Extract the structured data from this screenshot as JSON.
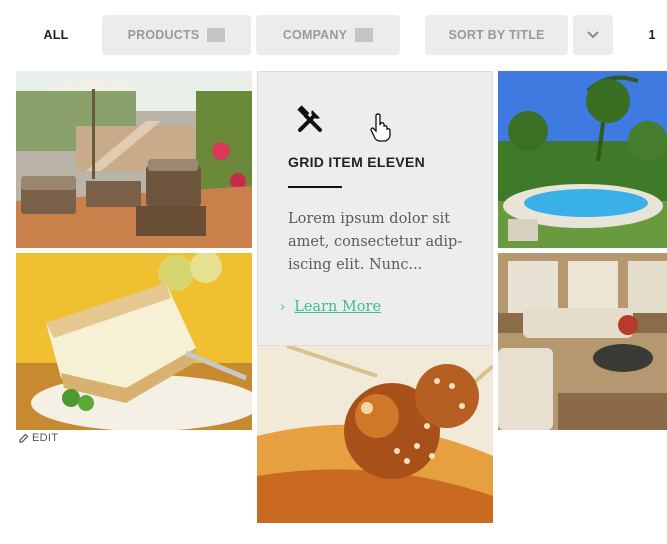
{
  "filters": {
    "all": "ALL",
    "products": "PRODUCTS",
    "company": "COMPANY",
    "sort": "SORT BY TITLE"
  },
  "pagination": {
    "page": "1"
  },
  "card": {
    "title": "GRID ITEM ELEVEN",
    "description": "Lorem ipsum dolor sit amet, consectetur adip-iscing elit. Nunc...",
    "link": "Learn More",
    "icon": "tools-icon"
  },
  "edit_label": "EDIT",
  "colors": {
    "accent": "#3bbf8c",
    "button_bg": "#ececec",
    "card_bg": "#ededed"
  }
}
